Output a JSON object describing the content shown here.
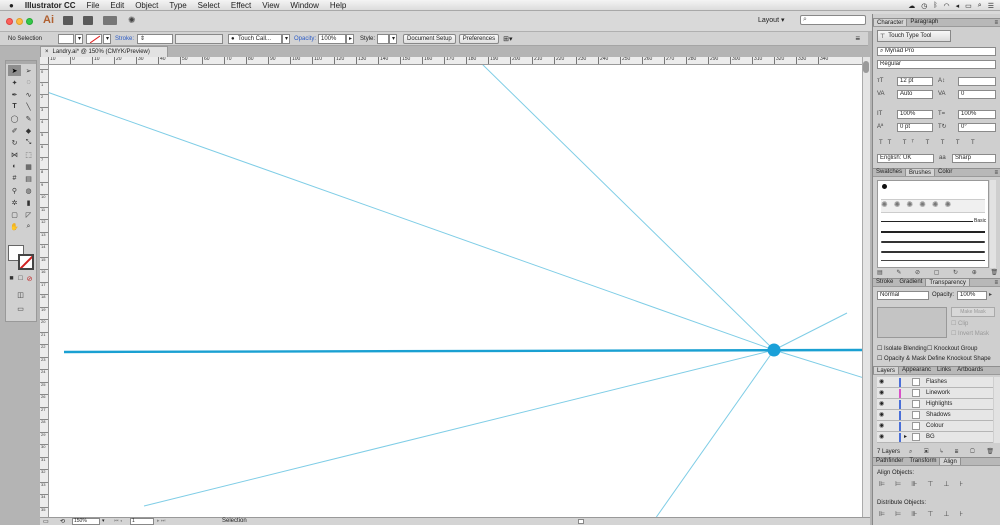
{
  "menubar": {
    "apple": "",
    "app_name": "Illustrator CC",
    "items": [
      "File",
      "Edit",
      "Object",
      "Type",
      "Select",
      "Effect",
      "View",
      "Window",
      "Help"
    ]
  },
  "appbar": {
    "logo": "Ai",
    "layout_label": "Layout",
    "search_placeholder": ""
  },
  "control_bar": {
    "selection_status": "No Selection",
    "stroke_label": "Stroke:",
    "brush_name": "Touch Call...",
    "opacity_label": "Opacity:",
    "opacity_value": "100%",
    "style_label": "Style:",
    "document_setup": "Document Setup",
    "preferences": "Preferences"
  },
  "document": {
    "tab_title": "Landry.ai* @ 150% (CMYK/Preview)",
    "top_ruler_ticks": [
      "10",
      "0",
      "10",
      "20",
      "30",
      "40",
      "50",
      "60",
      "70",
      "80",
      "90",
      "100",
      "110",
      "120",
      "130",
      "140",
      "150",
      "160",
      "170",
      "180",
      "190",
      "200",
      "210",
      "220",
      "230",
      "240",
      "250",
      "260",
      "270",
      "280",
      "290",
      "300",
      "310",
      "320",
      "330",
      "340"
    ],
    "left_ruler_ticks": [
      "0",
      "1",
      "2",
      "3",
      "4",
      "5",
      "6",
      "7",
      "8",
      "9",
      "10",
      "11",
      "12",
      "13",
      "14",
      "15",
      "16",
      "17",
      "18",
      "19",
      "20",
      "21",
      "22",
      "23",
      "24",
      "25",
      "26",
      "27",
      "28",
      "29",
      "30",
      "31",
      "32",
      "33",
      "34",
      "35"
    ],
    "line_color": "#7fcde6",
    "horizon_color": "#1aa0d2",
    "vanishing_point_color": "#1aa0d8"
  },
  "status": {
    "zoom": "150%",
    "page": "1",
    "mode": "Selection"
  },
  "character_panel": {
    "tabs": [
      "Character",
      "Paragraph"
    ],
    "touch_type_tool": "Touch Type Tool",
    "font_family": "Myriad Pro",
    "font_style": "Regular",
    "font_size": "12 pt",
    "leading": "",
    "kerning": "Auto",
    "tracking": "0",
    "vertical_scale": "100%",
    "horizontal_scale": "100%",
    "baseline_shift": "0 pt",
    "rotation": "0°",
    "language": "English: UK",
    "anti_alias": "Sharp"
  },
  "brushes_panel": {
    "tabs": [
      "Swatches",
      "Brushes",
      "Color"
    ],
    "basic_label": "Basic"
  },
  "transparency_panel": {
    "tabs": [
      "Stroke",
      "Gradient",
      "Transparency"
    ],
    "blend_mode": "Normal",
    "opacity_label": "Opacity:",
    "opacity_value": "100%",
    "make_mask": "Make Mask",
    "clip": "Clip",
    "invert_mask": "Invert Mask",
    "isolate_blending": "Isolate Blending",
    "knockout_group": "Knockout Group",
    "opacity_mask_define": "Opacity & Mask Define Knockout Shape"
  },
  "layers_panel": {
    "tabs": [
      "Layers",
      "Appearanc",
      "Links",
      "Artboards"
    ],
    "layers": [
      {
        "name": "Flashes",
        "color": "#4a6fd8"
      },
      {
        "name": "Linework",
        "color": "#d850c8"
      },
      {
        "name": "Highlights",
        "color": "#4a6fd8"
      },
      {
        "name": "Shadows",
        "color": "#4a6fd8"
      },
      {
        "name": "Colour",
        "color": "#4a6fd8"
      },
      {
        "name": "BG",
        "color": "#4a6fd8"
      }
    ],
    "count_label": "7 Layers"
  },
  "align_panel": {
    "tabs": [
      "Pathfinder",
      "Transform",
      "Align"
    ],
    "align_objects": "Align Objects:",
    "distribute_objects": "Distribute Objects:"
  }
}
